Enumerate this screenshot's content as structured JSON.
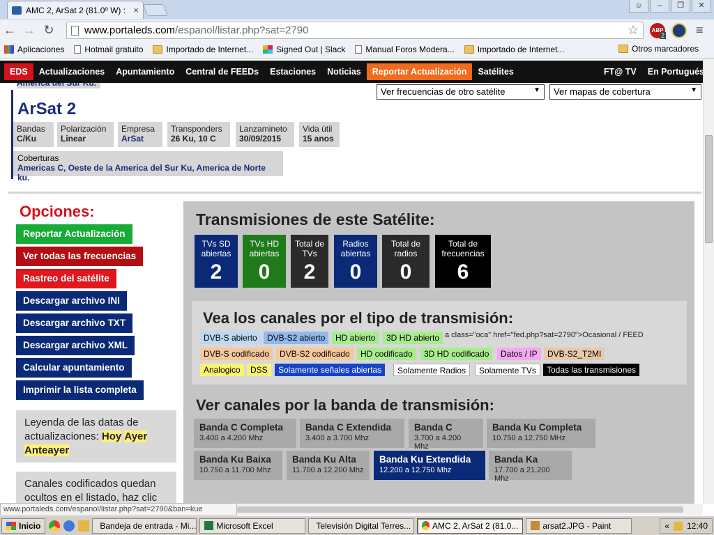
{
  "browser": {
    "tab_title": "AMC 2, ArSat 2 (81.0º W) :",
    "url_host": "www.portaleds.com",
    "url_path": "/espanol/listar.php?sat=2790",
    "abp_label": "ABP",
    "abp_count": "2",
    "bookmarks": [
      {
        "label": "Aplicaciones",
        "icon": "apps-icon"
      },
      {
        "label": "Hotmail gratuito",
        "icon": "page-icon"
      },
      {
        "label": "Importado de Internet...",
        "icon": "folder-icon"
      },
      {
        "label": "Signed Out | Slack",
        "icon": "slack-icon"
      },
      {
        "label": "Manual Foros Modera...",
        "icon": "page-icon"
      },
      {
        "label": "Importado de Internet...",
        "icon": "folder-icon"
      }
    ],
    "bookmarks_other": "Otros marcadores",
    "status_url": "www.portaleds.com/espanol/listar.php?sat=2790&ban=kue"
  },
  "site_nav": {
    "items": [
      "EDS",
      "Actualizaciones",
      "Apuntamiento",
      "Central de FEEDs",
      "Estaciones",
      "Noticias",
      "Reportar Actualización",
      "Satélites"
    ],
    "right": [
      "FT@ TV",
      "En Portugués"
    ]
  },
  "satellite": {
    "prev_coverage": "America del Sur Ku.",
    "name": "ArSat 2",
    "info": [
      {
        "label": "Bandas",
        "value": "C/Ku"
      },
      {
        "label": "Polarización",
        "value": "Linear"
      },
      {
        "label": "Empresa",
        "value": "ArSat"
      },
      {
        "label": "Transponders",
        "value": "26 Ku, 10 C"
      },
      {
        "label": "Lanzamineto",
        "value": "30/09/2015"
      },
      {
        "label": "Vida útil",
        "value": "15 anos"
      }
    ],
    "coverage_label": "Coberturas",
    "coverage_value": "Americas C, Oeste de la America del Sur Ku, America de Norte ku."
  },
  "selects": {
    "other_sat": "Ver frecuencias de otro satélite",
    "coverage_maps": "Ver mapas de cobertura"
  },
  "options": {
    "title": "Opciones:",
    "buttons": [
      {
        "label": "Reportar Actualización",
        "color": "#16ac35"
      },
      {
        "label": "Ver todas las frecuencias",
        "color": "#b30e13"
      },
      {
        "label": "Rastreo del satélite",
        "color": "#e2161d"
      },
      {
        "label": "Descargar archivo INI",
        "color": "#0a2a78"
      },
      {
        "label": "Descargar archivo TXT",
        "color": "#0a2a78"
      },
      {
        "label": "Descargar archivo XML",
        "color": "#0a2a78"
      },
      {
        "label": "Calcular apuntamiento",
        "color": "#0a2a78"
      },
      {
        "label": "Imprimir la lista completa",
        "color": "#0a2a78"
      }
    ],
    "legend_text": "Leyenda de las datas de actualizaciones:",
    "legend_hoy": "Hoy",
    "legend_ayer": "Ayer",
    "legend_anteayer": "Anteayer",
    "codif_text": "Canales codificados quedan ocultos en el listado, haz clic"
  },
  "transmissions": {
    "title": "Transmisiones de este Satélite:",
    "stats": [
      {
        "label": "TVs SD abiertas",
        "value": "2"
      },
      {
        "label": "TVs HD abiertas",
        "value": "0"
      },
      {
        "label": "Total de TVs",
        "value": "2"
      },
      {
        "label": "Radios abiertas",
        "value": "0"
      },
      {
        "label": "Total de radios",
        "value": "0"
      },
      {
        "label": "Total de frecuencias",
        "value": "6"
      }
    ]
  },
  "types": {
    "title": "Vea los canales por el tipo de transmisión:",
    "raw_text": "a class=\"oca\" href=\"fed.php?sat=2790\">Ocasional / FEED",
    "tags": [
      "DVB-S abierto",
      "DVB-S2 abierto",
      "HD abierto",
      "3D HD abierto",
      "DVB-S codificado",
      "DVB-S2 codificado",
      "HD codificado",
      "3D HD codificado",
      "Datos / IP",
      "DVB-S2_T2MI",
      "Analogico",
      "DSS",
      "Solamente señales abiertas",
      "Solamente Radios",
      "Solamente TVs",
      "Todas las transmisiones"
    ]
  },
  "bands": {
    "title": "Ver canales por la banda de transmisión:",
    "items": [
      {
        "name": "Banda C Completa",
        "range": "3.400 a 4.200 Mhz"
      },
      {
        "name": "Banda C Extendida",
        "range": "3.400 a 3.700 Mhz"
      },
      {
        "name": "Banda C",
        "range": "3.700 a 4.200 Mhz"
      },
      {
        "name": "Banda Ku Completa",
        "range": "10.750 a 12.750 MHz"
      },
      {
        "name": "Banda Ku Baixa",
        "range": "10.750 a 11.700 Mhz"
      },
      {
        "name": "Banda Ku Alta",
        "range": "11.700 a 12.200 Mhz"
      },
      {
        "name": "Banda Ku Extendida",
        "range": "12.200 a 12.750 Mhz"
      },
      {
        "name": "Banda Ka",
        "range": "17.700 a 21.200 Mhz"
      }
    ]
  },
  "taskbar": {
    "start": "Inicio",
    "tasks": [
      "Bandeja de entrada - Mi...",
      "Microsoft Excel",
      "Televisión Digital Terres...",
      "AMC 2, ArSat 2 (81.0...",
      "arsat2.JPG - Paint"
    ],
    "clock": "12:40"
  }
}
